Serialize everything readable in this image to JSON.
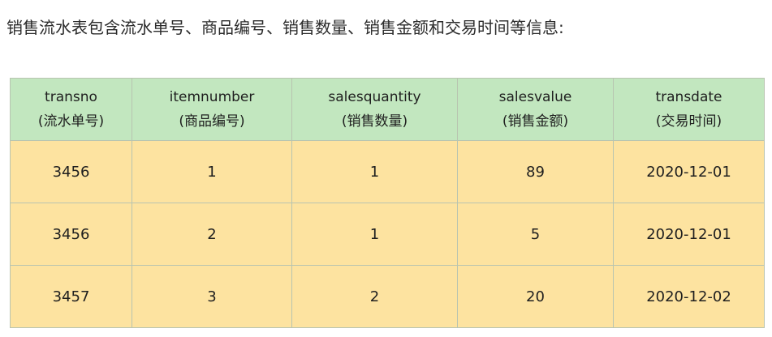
{
  "intro_text": "销售流水表包含流水单号、商品编号、销售数量、销售金额和交易时间等信息:",
  "table": {
    "headers": [
      {
        "field": "transno",
        "label": "(流水单号)"
      },
      {
        "field": "itemnumber",
        "label": "(商品编号)"
      },
      {
        "field": "salesquantity",
        "label": "(销售数量)"
      },
      {
        "field": "salesvalue",
        "label": "(销售金额)"
      },
      {
        "field": "transdate",
        "label": "(交易时间)"
      }
    ],
    "rows": [
      [
        "3456",
        "1",
        "1",
        "89",
        "2020-12-01"
      ],
      [
        "3456",
        "2",
        "1",
        "5",
        "2020-12-01"
      ],
      [
        "3457",
        "3",
        "2",
        "20",
        "2020-12-02"
      ]
    ]
  },
  "colors": {
    "header_bg": "#c2e7bf",
    "body_bg": "#fde3a0",
    "border": "#b8c4b0"
  }
}
